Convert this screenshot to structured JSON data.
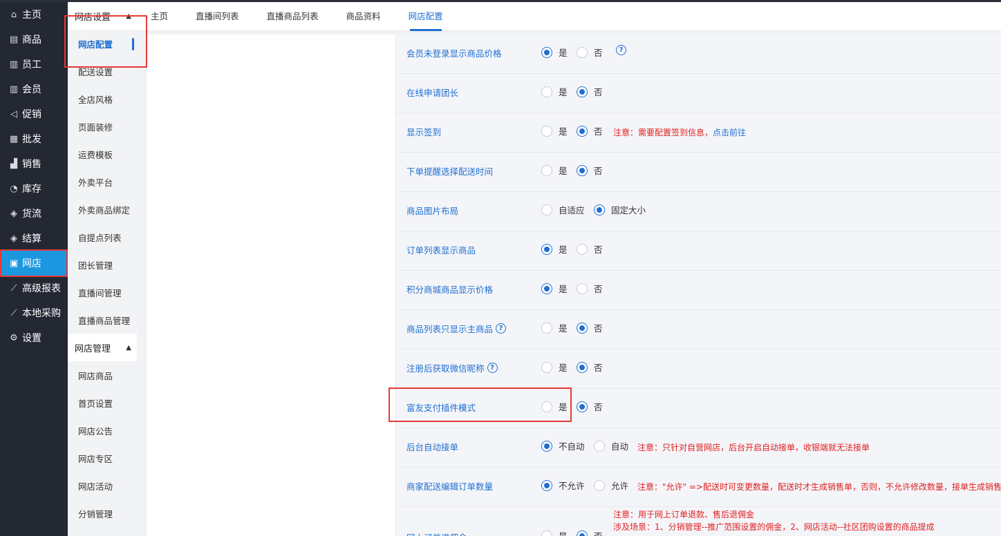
{
  "nav": [
    {
      "icon": "home-icon",
      "glyph": "⌂",
      "label": "主页",
      "active": false
    },
    {
      "icon": "goods-icon",
      "glyph": "▤",
      "label": "商品",
      "active": false
    },
    {
      "icon": "staff-icon",
      "glyph": "▥",
      "label": "员工",
      "active": false
    },
    {
      "icon": "member-icon",
      "glyph": "▥",
      "label": "会员",
      "active": false
    },
    {
      "icon": "promo-icon",
      "glyph": "◁",
      "label": "促销",
      "active": false
    },
    {
      "icon": "wholesale-icon",
      "glyph": "▦",
      "label": "批发",
      "active": false
    },
    {
      "icon": "sales-icon",
      "glyph": "▟",
      "label": "销售",
      "active": false
    },
    {
      "icon": "stock-icon",
      "glyph": "◔",
      "label": "库存",
      "active": false
    },
    {
      "icon": "logistics-icon",
      "glyph": "◈",
      "label": "货流",
      "active": false
    },
    {
      "icon": "settle-icon",
      "glyph": "◈",
      "label": "结算",
      "active": false
    },
    {
      "icon": "gift-icon",
      "glyph": "▣",
      "label": "网店",
      "active": true
    },
    {
      "icon": "report-icon",
      "glyph": "⟋",
      "label": "高级报表",
      "active": false
    },
    {
      "icon": "purchase-icon",
      "glyph": "⟋",
      "label": "本地采购",
      "active": false
    },
    {
      "icon": "gear-icon",
      "glyph": "⚙",
      "label": "设置",
      "active": false
    }
  ],
  "submenu": {
    "group1": "网店设置",
    "group1_items": [
      "网店配置",
      "配送设置",
      "全店风格",
      "页面装修",
      "运费模板",
      "外卖平台",
      "外卖商品绑定",
      "自提点列表",
      "团长管理",
      "直播间管理",
      "直播商品管理"
    ],
    "group2": "网店管理",
    "group2_items": [
      "网店商品",
      "首页设置",
      "网店公告",
      "网店专区",
      "网店活动",
      "分销管理"
    ]
  },
  "tabs": [
    {
      "label": "主页",
      "active": false
    },
    {
      "label": "直播间列表",
      "active": false
    },
    {
      "label": "直播商品列表",
      "active": false
    },
    {
      "label": "商品资料",
      "active": false
    },
    {
      "label": "网店配置",
      "active": true
    }
  ],
  "rows": [
    {
      "label": "会员未登录显示商品价格",
      "help_after": true,
      "options": [
        {
          "text": "是",
          "on": true
        },
        {
          "text": "否",
          "on": false
        }
      ],
      "note": "",
      "note_link": ""
    },
    {
      "label": "在线申请团长",
      "help": false,
      "options": [
        {
          "text": "是",
          "on": false
        },
        {
          "text": "否",
          "on": true
        }
      ],
      "note": "",
      "note_link": ""
    },
    {
      "label": "显示签到",
      "help": false,
      "options": [
        {
          "text": "是",
          "on": false
        },
        {
          "text": "否",
          "on": true
        }
      ],
      "note": "注意：需要配置签到信息，",
      "note_link": "点击前往"
    },
    {
      "label": "下单提醒选择配送时间",
      "help": false,
      "options": [
        {
          "text": "是",
          "on": false
        },
        {
          "text": "否",
          "on": true
        }
      ],
      "note": "",
      "note_link": ""
    },
    {
      "label": "商品图片布局",
      "help": false,
      "options": [
        {
          "text": "自适应",
          "on": false
        },
        {
          "text": "固定大小",
          "on": true
        }
      ],
      "note": "",
      "note_link": ""
    },
    {
      "label": "订单列表显示商品",
      "help": false,
      "options": [
        {
          "text": "是",
          "on": true
        },
        {
          "text": "否",
          "on": false
        }
      ],
      "note": "",
      "note_link": ""
    },
    {
      "label": "积分商城商品显示价格",
      "help": false,
      "options": [
        {
          "text": "是",
          "on": true
        },
        {
          "text": "否",
          "on": false
        }
      ],
      "note": "",
      "note_link": ""
    },
    {
      "label": "商品列表只显示主商品",
      "help": true,
      "options": [
        {
          "text": "是",
          "on": false
        },
        {
          "text": "否",
          "on": true
        }
      ],
      "note": "",
      "note_link": ""
    },
    {
      "label": "注册后获取微信昵称",
      "help": true,
      "options": [
        {
          "text": "是",
          "on": false
        },
        {
          "text": "否",
          "on": true
        }
      ],
      "note": "",
      "note_link": ""
    },
    {
      "label": "富友支付插件模式",
      "help": false,
      "options": [
        {
          "text": "是",
          "on": false
        },
        {
          "text": "否",
          "on": true
        }
      ],
      "note": "",
      "note_link": ""
    },
    {
      "label": "后台自动接单",
      "help": false,
      "options": [
        {
          "text": "不自动",
          "on": true
        },
        {
          "text": "自动",
          "on": false
        }
      ],
      "note": "注意：只针对自营网店，后台开启自动接单，收银端就无法接单",
      "note_link": ""
    },
    {
      "label": "商家配送编辑订单数量",
      "help": false,
      "options": [
        {
          "text": "不允许",
          "on": true
        },
        {
          "text": "允许",
          "on": false
        }
      ],
      "note": "注意：\"允许\" =>配送时可变更数量，配送时才生成销售单，否则，不允许修改数量，接单生成销售单",
      "note_link": ""
    },
    {
      "label": "网上订单退佣金",
      "help": false,
      "options": [
        {
          "text": "是",
          "on": false
        },
        {
          "text": "否",
          "on": true
        }
      ],
      "note": "注意：用于网上订单退款、售后退佣金",
      "note2": "涉及场景：1、分销管理--推广范围设置的佣金，2、网店活动--社区团购设置的商品提成",
      "note_link": ""
    }
  ]
}
